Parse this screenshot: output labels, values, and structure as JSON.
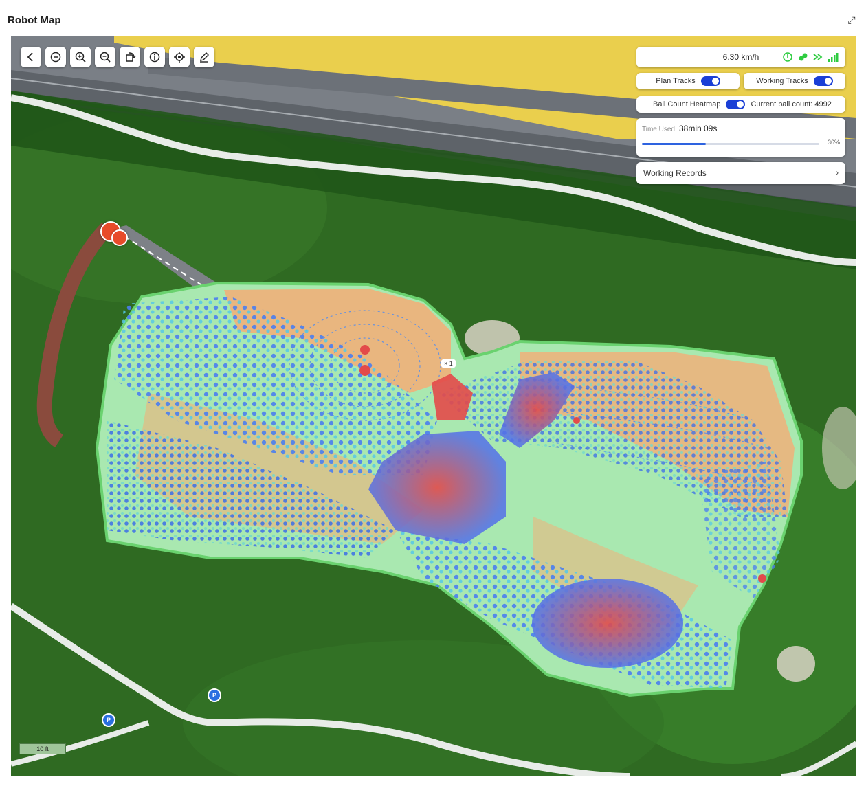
{
  "window": {
    "title": "Robot Map",
    "fullscreen_icon": "fullscreen-icon"
  },
  "toolbar": {
    "buttons": [
      {
        "name": "back-button",
        "icon": "chevron-left-icon"
      },
      {
        "name": "minus-button",
        "icon": "minus-circle-icon"
      },
      {
        "name": "zoom-in-button",
        "icon": "zoom-in-icon"
      },
      {
        "name": "zoom-out-button",
        "icon": "zoom-out-icon"
      },
      {
        "name": "rotate-button",
        "icon": "rotate-icon"
      },
      {
        "name": "info-button",
        "icon": "info-icon"
      },
      {
        "name": "locate-button",
        "icon": "locate-icon"
      },
      {
        "name": "edit-button",
        "icon": "pencil-icon"
      }
    ]
  },
  "status": {
    "speed": "6.30 km/h",
    "icons": [
      "power-icon",
      "ball-icon",
      "signal-arrows-icon",
      "signal-bars-icon"
    ],
    "accent_color": "#2ecc40"
  },
  "toggles": {
    "plan_tracks_label": "Plan Tracks",
    "plan_tracks_on": true,
    "working_tracks_label": "Working Tracks",
    "working_tracks_on": true,
    "heatmap_label": "Ball Count Heatmap",
    "heatmap_on": true,
    "ball_count_text": "Current ball count: 4992"
  },
  "time": {
    "label": "Time Used",
    "value": "38min 09s",
    "percent_text": "36%",
    "progress": 0.36
  },
  "records": {
    "label": "Working Records",
    "chevron": "›"
  },
  "map": {
    "scale_label": "10 ft",
    "marker_x_label": "× 1",
    "parking_markers": [
      "P",
      "P"
    ],
    "colors": {
      "grass": "#2f6a22",
      "road_yellow": "#f0d44a",
      "area_fill": "#9fe0a8",
      "sand_fill": "#f0b07a",
      "heat_red": "#e34a4a",
      "heat_blue": "#3e6fe0",
      "path_white": "#e8ece8"
    }
  }
}
